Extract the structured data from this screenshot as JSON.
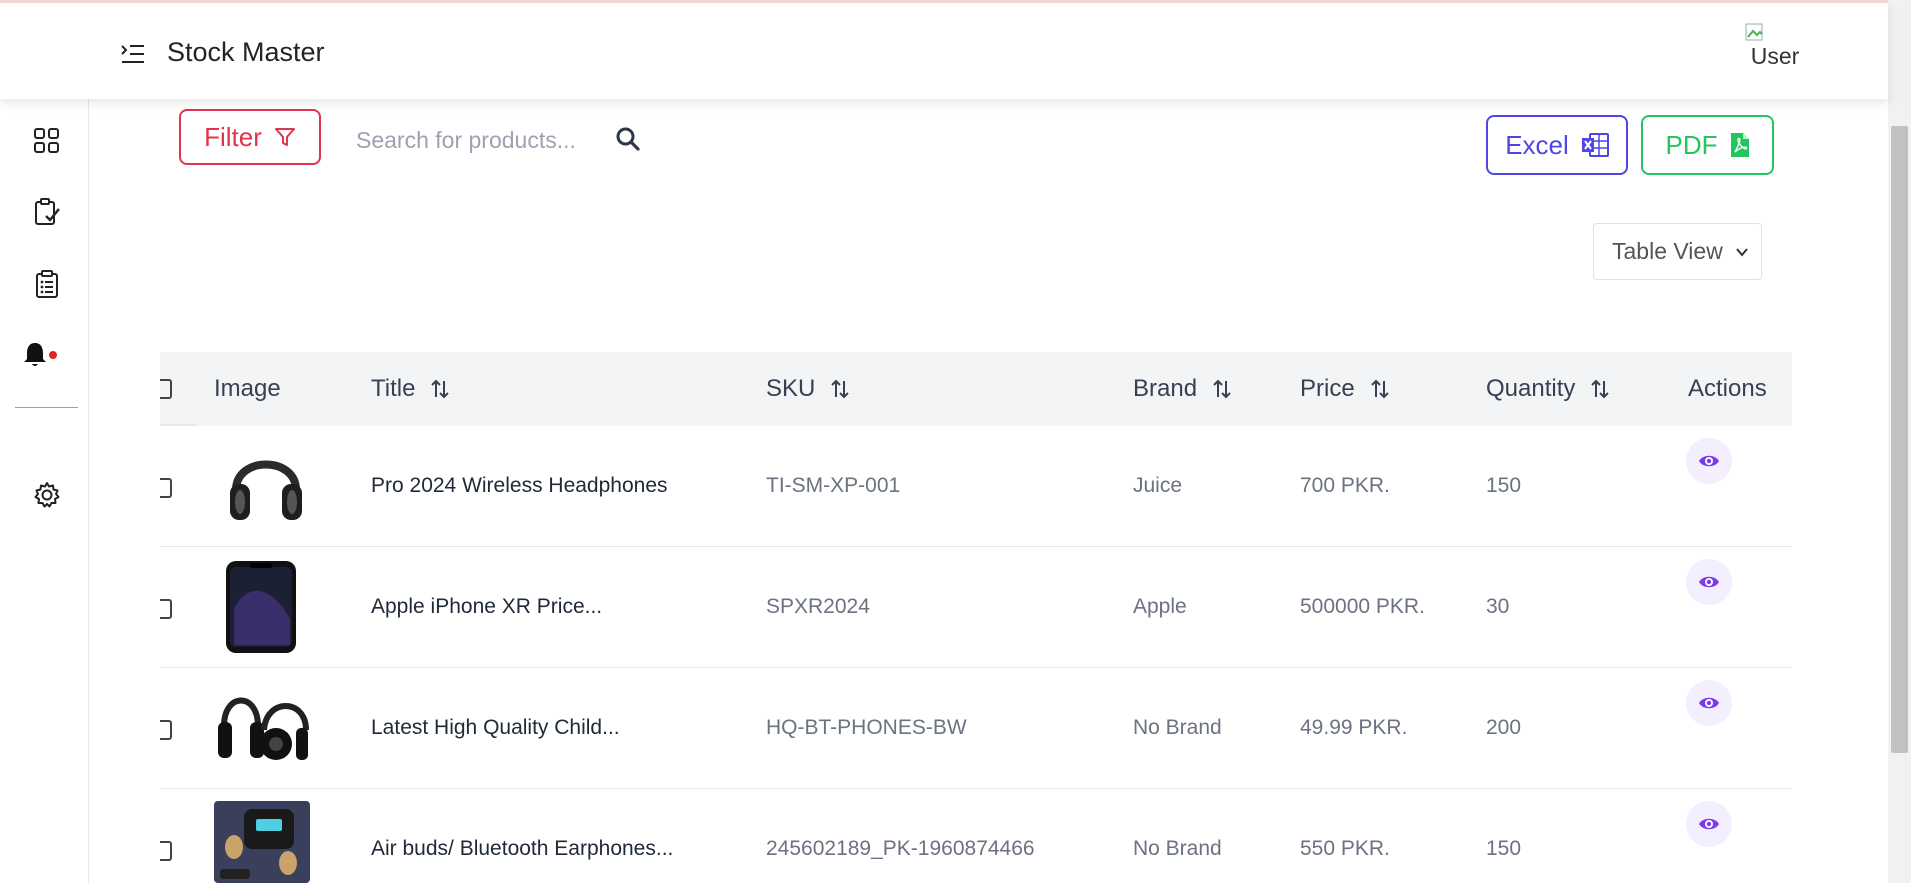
{
  "app": {
    "brand": "Stock Master",
    "user_alt": "User"
  },
  "toolbar": {
    "filter_label": "Filter",
    "search_placeholder": "Search for products...",
    "excel_label": "Excel",
    "pdf_label": "PDF",
    "view_select": "Table View"
  },
  "colors": {
    "filter": "#e0344f",
    "excel": "#4f46e5",
    "pdf": "#22c55e",
    "eye": "#7c3aed",
    "notification_dot": "#dc2626"
  },
  "sidebar": {
    "items": [
      {
        "icon": "dashboard-grid-icon"
      },
      {
        "icon": "clipboard-check-icon"
      },
      {
        "icon": "clipboard-list-icon"
      },
      {
        "icon": "bell-icon",
        "has_notification": true
      },
      {
        "icon": "gear-icon"
      }
    ]
  },
  "table": {
    "columns": [
      "Image",
      "Title",
      "SKU",
      "Brand",
      "Price",
      "Quantity",
      "Actions"
    ],
    "rows": [
      {
        "title": "Pro 2024 Wireless Headphones",
        "sku": "TI-SM-XP-001",
        "brand": "Juice",
        "price": "700 PKR.",
        "quantity": "150",
        "image": "headphones"
      },
      {
        "title": "Apple iPhone XR Price...",
        "sku": "SPXR2024",
        "brand": "Apple",
        "price": "500000 PKR.",
        "quantity": "30",
        "image": "iphone"
      },
      {
        "title": "Latest High Quality Child...",
        "sku": "HQ-BT-PHONES-BW",
        "brand": "No Brand",
        "price": "49.99 PKR.",
        "quantity": "200",
        "image": "headphones-pair"
      },
      {
        "title": "Air buds/ Bluetooth Earphones...",
        "sku": "245602189_PK-1960874466",
        "brand": "No Brand",
        "price": "550 PKR.",
        "quantity": "150",
        "image": "earbuds"
      }
    ]
  }
}
